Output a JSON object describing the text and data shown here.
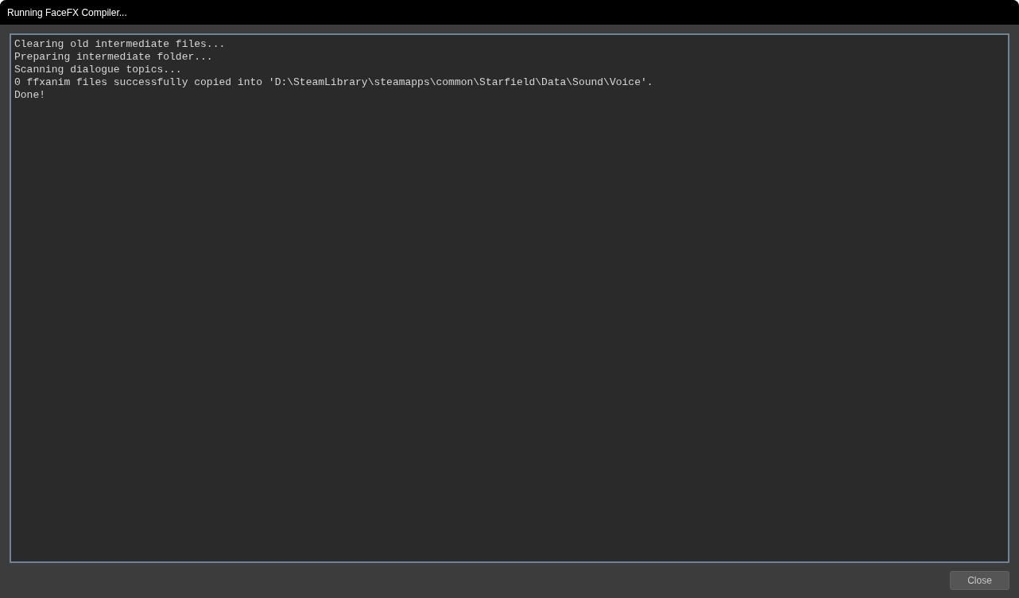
{
  "window": {
    "title": "Running FaceFX Compiler..."
  },
  "output_log": {
    "lines": [
      "Clearing old intermediate files...",
      "Preparing intermediate folder...",
      "Scanning dialogue topics...",
      "0 ffxanim files successfully copied into 'D:\\SteamLibrary\\steamapps\\common\\Starfield\\Data\\Sound\\Voice'.",
      "Done!"
    ]
  },
  "buttons": [
    "Close"
  ]
}
